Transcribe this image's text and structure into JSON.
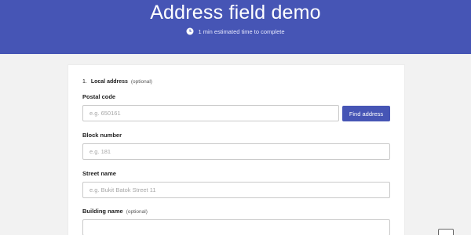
{
  "header": {
    "title": "Address field demo",
    "estimate": "1 min estimated time to complete",
    "background_color": "#4655b5",
    "icon": "clock-icon"
  },
  "form": {
    "section": {
      "number": "1.",
      "title": "Local address",
      "optional": "(optional)"
    },
    "postal_code": {
      "label": "Postal code",
      "placeholder": "e.g. 650161",
      "value": ""
    },
    "find_button": "Find address",
    "block_number": {
      "label": "Block number",
      "placeholder": "e.g. 181",
      "value": ""
    },
    "street_name": {
      "label": "Street name",
      "placeholder": "e.g. Bukit Batok Street 11",
      "value": ""
    },
    "building_name": {
      "label": "Building name",
      "optional": "(optional)",
      "placeholder": "",
      "value": ""
    },
    "accent_color": "#4655b5"
  }
}
